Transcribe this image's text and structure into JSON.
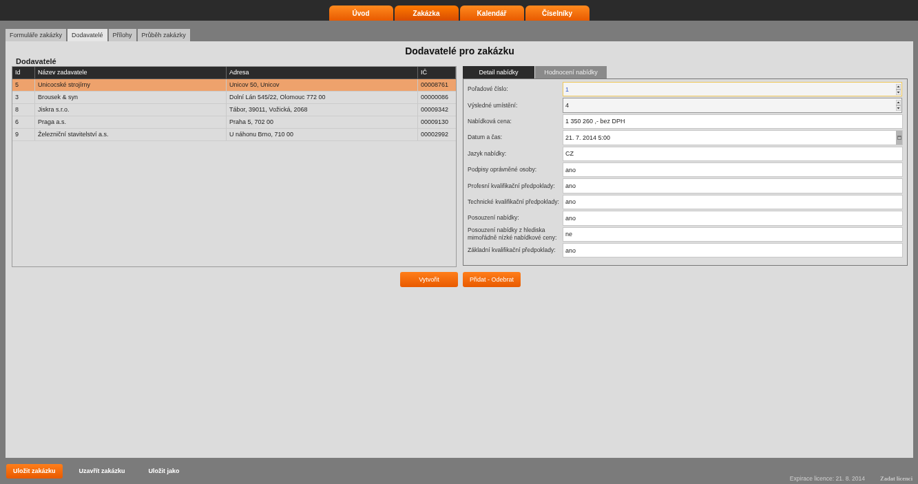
{
  "main_nav": [
    {
      "label": "Úvod",
      "selected": false
    },
    {
      "label": "Zakázka",
      "selected": true
    },
    {
      "label": "Kalendář",
      "selected": false
    },
    {
      "label": "Číselníky",
      "selected": false
    }
  ],
  "sub_tabs": [
    {
      "label": "Formuláře zakázky",
      "selected": false
    },
    {
      "label": "Dodavatelé",
      "selected": true
    },
    {
      "label": "Přílohy",
      "selected": false
    },
    {
      "label": "Průběh zakázky",
      "selected": false
    }
  ],
  "page_title": "Dodavatelé pro zakázku",
  "section_title": "Dodavatelé",
  "table": {
    "columns": [
      "Id",
      "Název zadavatele",
      "Adresa",
      "IČ"
    ],
    "rows": [
      {
        "cells": [
          "5",
          "Unicocské strojírny",
          "Unicov 50, Unicov",
          "00008761"
        ],
        "selected": true
      },
      {
        "cells": [
          "3",
          "Brousek & syn",
          "Dolní Lán 545/22, Olomouc 772 00",
          "00000086"
        ],
        "selected": false
      },
      {
        "cells": [
          "8",
          "Jiskra s.r.o.",
          "Tábor, 39011, Vožická, 2068",
          "00009342"
        ],
        "selected": false
      },
      {
        "cells": [
          "6",
          "Praga a.s.",
          "Praha 5, 702 00",
          "00009130"
        ],
        "selected": false
      },
      {
        "cells": [
          "9",
          "Železniční stavitelství a.s.",
          "U náhonu Brno, 710 00",
          "00002992"
        ],
        "selected": false
      }
    ]
  },
  "buttons": [
    "Vytvořit",
    "Přidat - Odebrat"
  ],
  "detail_tabs": [
    {
      "label": "Detail nabídky",
      "selected": true
    },
    {
      "label": "Hodnocení nabídky",
      "selected": false
    }
  ],
  "fields": [
    {
      "label": "Pořadové číslo:",
      "value": "1",
      "kind": "spin",
      "focused": true
    },
    {
      "label": "Výsledné umístění:",
      "value": "4",
      "kind": "spin",
      "focused": false
    },
    {
      "label": "Nabídková cena:",
      "value": "1 350 260 ,- bez DPH",
      "kind": "text",
      "focused": false
    },
    {
      "label": "Datum a čas:",
      "value": "21. 7. 2014 5:00",
      "kind": "date",
      "focused": false
    },
    {
      "label": "Jazyk nabídky:",
      "value": "CZ",
      "kind": "text",
      "focused": false
    },
    {
      "label": "Podpisy oprávněné osoby:",
      "value": "ano",
      "kind": "text",
      "focused": false
    },
    {
      "label": "Profesní kvalifikační předpoklady:",
      "value": "ano",
      "kind": "text",
      "focused": false
    },
    {
      "label": "Technické kvalifikační předpoklady:",
      "value": "ano",
      "kind": "text",
      "focused": false
    },
    {
      "label": "Posouzení nabídky:",
      "value": "ano",
      "kind": "text",
      "focused": false
    },
    {
      "label": "Posouzení nabídky z hlediska mimořádně nízké nabídkové ceny:",
      "value": "ne",
      "kind": "text",
      "focused": false
    },
    {
      "label": "Základní kvalifikační předpoklady:",
      "value": "ano",
      "kind": "text",
      "focused": false
    }
  ],
  "footer": {
    "actions": [
      {
        "label": "Uložit zakázku",
        "primary": true
      },
      {
        "label": "Uzavřít zakázku",
        "primary": false
      },
      {
        "label": "Uložit jako",
        "primary": false
      }
    ],
    "license_expiry": "Expirace licence: 21. 8. 2014",
    "license_link": "Zadat licenci"
  }
}
